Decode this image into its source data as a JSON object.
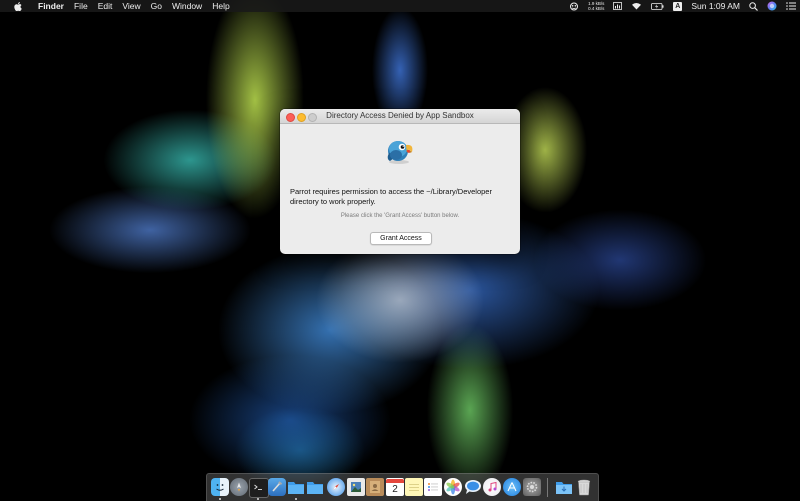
{
  "menubar": {
    "app_name": "Finder",
    "menus": [
      "File",
      "Edit",
      "View",
      "Go",
      "Window",
      "Help"
    ],
    "network_up": "1.9 kB/s",
    "network_down": "0.4 kB/s",
    "input_source": "A",
    "clock": "Sun 1:09 AM"
  },
  "dialog": {
    "title": "Directory Access Denied by App Sandbox",
    "message": "Parrot requires permission to access the ~/Library/Developer directory to work properly.",
    "hint": "Please click the 'Grant Access' button below.",
    "button_label": "Grant Access"
  },
  "dock": {
    "items": [
      {
        "name": "finder",
        "icon": "finder-icon",
        "running": true
      },
      {
        "name": "launchpad",
        "icon": "launchpad-icon",
        "running": false
      },
      {
        "name": "terminal",
        "icon": "terminal-icon",
        "running": true
      },
      {
        "name": "xcode",
        "icon": "xcode-icon",
        "running": false
      },
      {
        "name": "folder",
        "icon": "folder-icon",
        "running": true
      },
      {
        "name": "folder-2",
        "icon": "folder-icon",
        "running": false
      },
      {
        "name": "safari",
        "icon": "safari-icon",
        "running": false
      },
      {
        "name": "preview",
        "icon": "preview-icon",
        "running": false
      },
      {
        "name": "contacts",
        "icon": "contacts-icon",
        "running": false
      },
      {
        "name": "calendar",
        "icon": "calendar-icon",
        "running": false
      },
      {
        "name": "notes",
        "icon": "notes-icon",
        "running": false
      },
      {
        "name": "reminders",
        "icon": "reminders-icon",
        "running": false
      },
      {
        "name": "photos",
        "icon": "photos-icon",
        "running": false
      },
      {
        "name": "messages",
        "icon": "messages-icon",
        "running": false
      },
      {
        "name": "itunes",
        "icon": "itunes-icon",
        "running": false
      },
      {
        "name": "app-store",
        "icon": "app-store-icon",
        "running": false
      },
      {
        "name": "system-preferences",
        "icon": "system-preferences-icon",
        "running": false
      },
      {
        "name": "downloads",
        "icon": "downloads-folder-icon",
        "running": false
      },
      {
        "name": "trash",
        "icon": "trash-icon",
        "running": false
      }
    ],
    "calendar_day": "2"
  },
  "colors": {
    "close": "#fc5f57",
    "minimize": "#fdbc2e",
    "zoom": "#cdcdcd"
  }
}
